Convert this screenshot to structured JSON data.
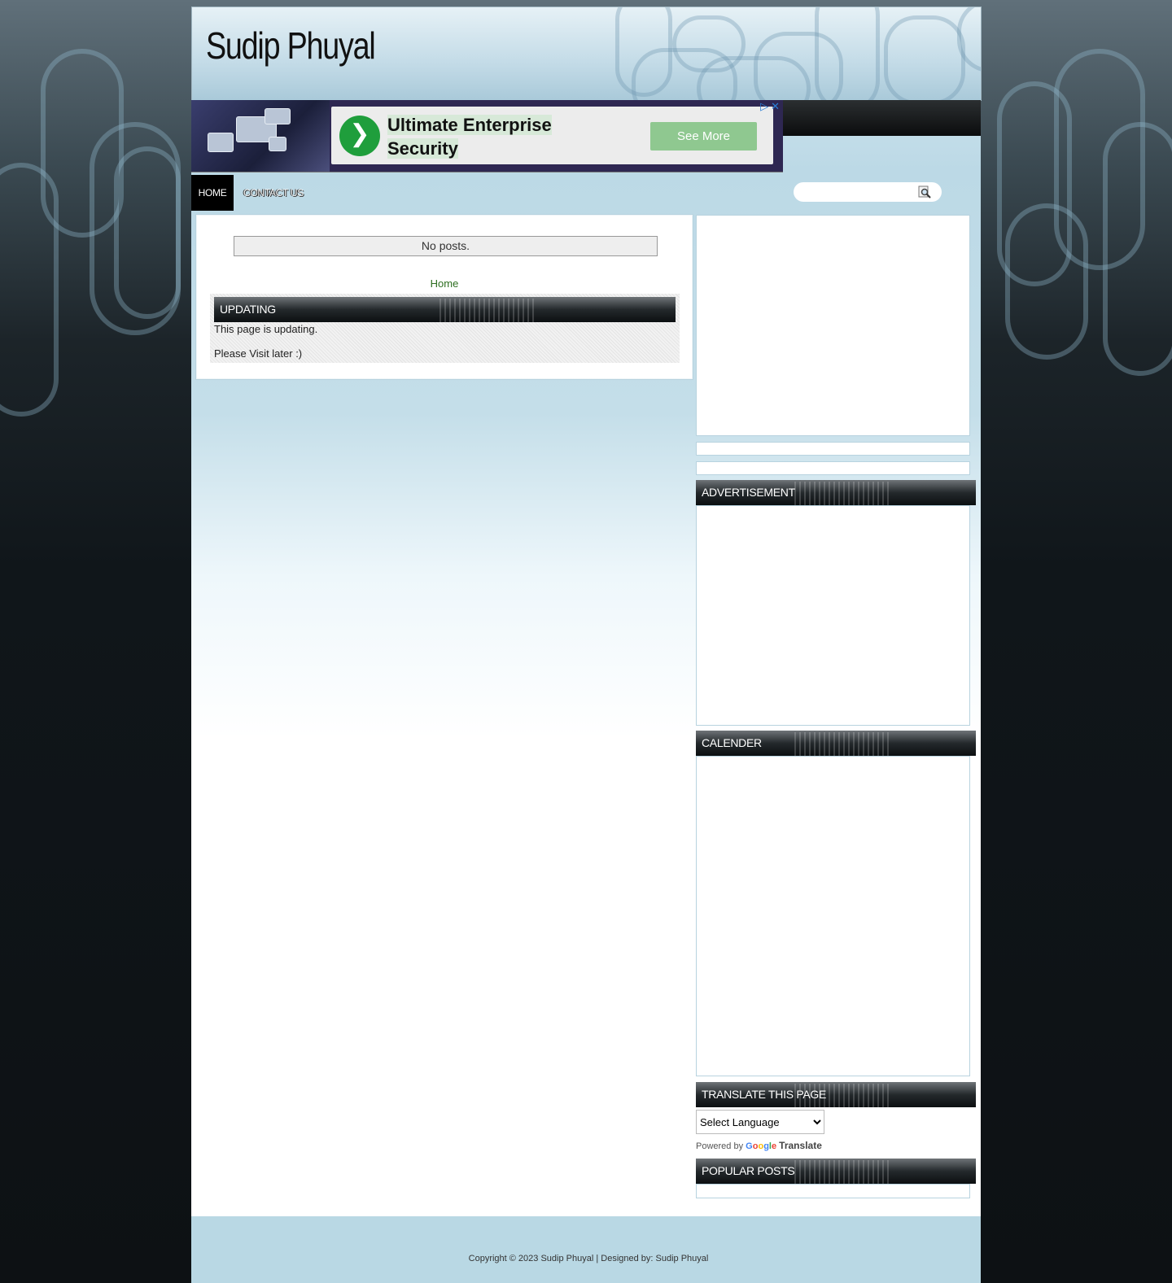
{
  "site": {
    "title": "Sudip Phuyal"
  },
  "ad": {
    "headline": "Ultimate Enterprise Security",
    "headline_line1": "Ultimate Enterprise",
    "headline_line2": "Security",
    "cta": "See More",
    "adchoices_icon": "play-triangle-icon",
    "close_icon": "close-icon"
  },
  "nav": {
    "items": [
      {
        "label": "HOME",
        "active": true
      },
      {
        "label": "CONTACT US",
        "active": false
      }
    ]
  },
  "search": {
    "placeholder": "",
    "icon": "magnifier-icon"
  },
  "main": {
    "no_posts": "No posts.",
    "home_link": "Home",
    "widget": {
      "title": "UPDATING",
      "line1": "This page is updating.",
      "line2": "Please Visit later :)"
    }
  },
  "sidebar": {
    "advertisement_title": "ADVERTISEMENT",
    "calender_title": "CALENDER",
    "translate_title": "TRANSLATE THIS PAGE",
    "language_select": "Select Language",
    "powered_by": "Powered by",
    "google": "Google",
    "translate": "Translate",
    "popular_title": "POPULAR POSTS"
  },
  "footer": {
    "text": "Copyright © 2023 Sudip Phuyal | Designed by: Sudip Phuyal"
  },
  "colors": {
    "link_green": "#2c6e1f",
    "ad_button": "#8fc890",
    "ad_logo": "#1f9e3c",
    "footer_bg": "#b9d8e4"
  }
}
